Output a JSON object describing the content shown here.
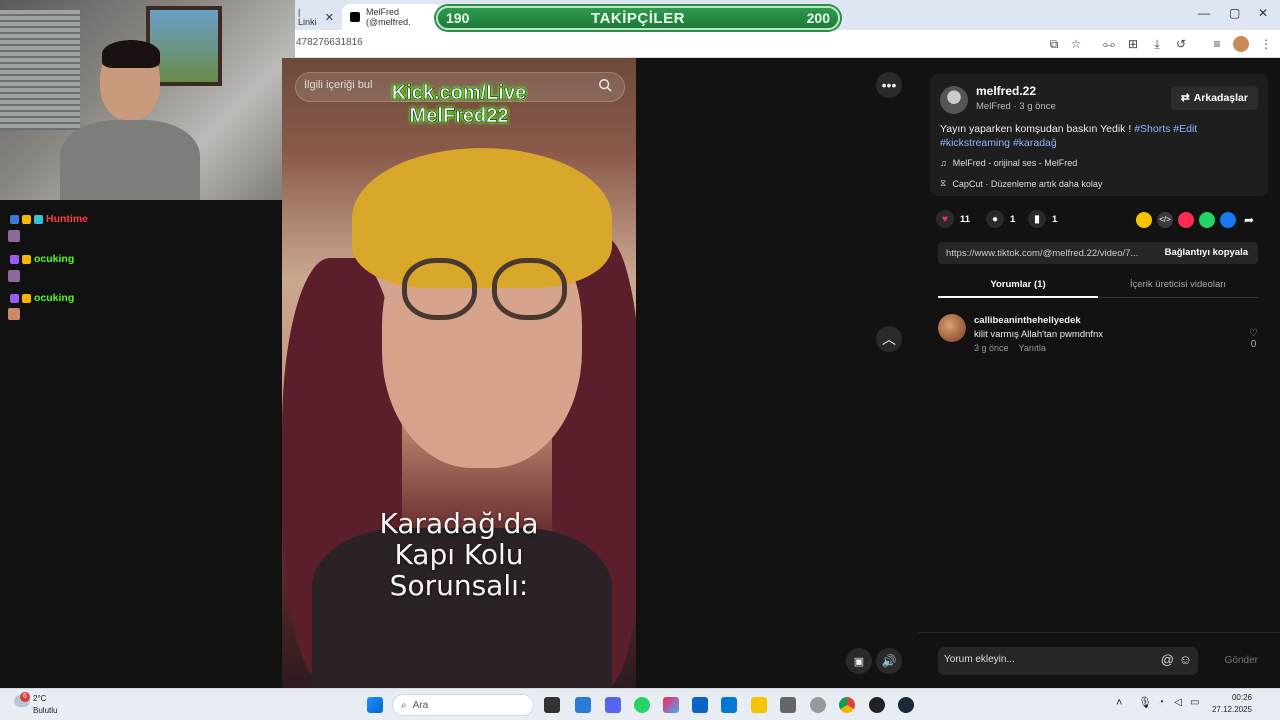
{
  "browser": {
    "tabs": [
      {
        "label": "| Linki"
      },
      {
        "label": "MelFred (@melfred."
      }
    ],
    "url": "478276631816",
    "window_controls": [
      "—",
      "▢",
      "✕"
    ]
  },
  "follower_goal": {
    "current": "190",
    "label": "TAKİPÇİLER",
    "target": "200"
  },
  "overlay": {
    "kick_line1": "Kick.com/Live",
    "kick_line2": "MelFred22"
  },
  "chat": [
    {
      "user": "Huntime",
      "color": "#ff3b3b"
    },
    {
      "user": "ocuking",
      "color": "#53fc18"
    },
    {
      "user": "ocuking",
      "color": "#53fc18"
    }
  ],
  "video": {
    "search_placeholder": "İlgili içeriği bul",
    "caption": [
      "Karadağ'da",
      "Kapı Kolu",
      "Sorunsalı:"
    ]
  },
  "post": {
    "username": "melfred.22",
    "subtitle": "MelFred · 3 g önce",
    "friends_label": "Arkadaşlar",
    "desc_text": "Yayın yaparken komşudan baskın Yedik ! ",
    "hashtags": [
      "#Shorts",
      "#Edit",
      "#kickstreaming",
      "#karadağ"
    ],
    "sound": "MelFred - orijinal ses - MelFred",
    "capcut": "CapCut · Düzenleme artık daha kolay",
    "likes": "11",
    "comments": "1",
    "saves": "1",
    "link": "https://www.tiktok.com/@melfred.22/video/7...",
    "copy_label": "Bağlantıyı kopyala",
    "tab_comments": "Yorumlar (1)",
    "tab_creator": "İçerik üreticisi videoları"
  },
  "comment": {
    "user": "callibeaninthehellyedek",
    "text": "kilit varmış Allah'tan pwmdnfnx",
    "time": "3 g önce",
    "reply": "Yanıtla",
    "likes": "0"
  },
  "comment_box": {
    "placeholder": "Yorum ekleyin...",
    "send": "Gönder"
  },
  "taskbar": {
    "weather_temp": "2°C",
    "weather_desc": "Bulutlu",
    "weather_badge": "6",
    "search": "Ara",
    "time": "00:26",
    "date": "27.12.2025"
  }
}
